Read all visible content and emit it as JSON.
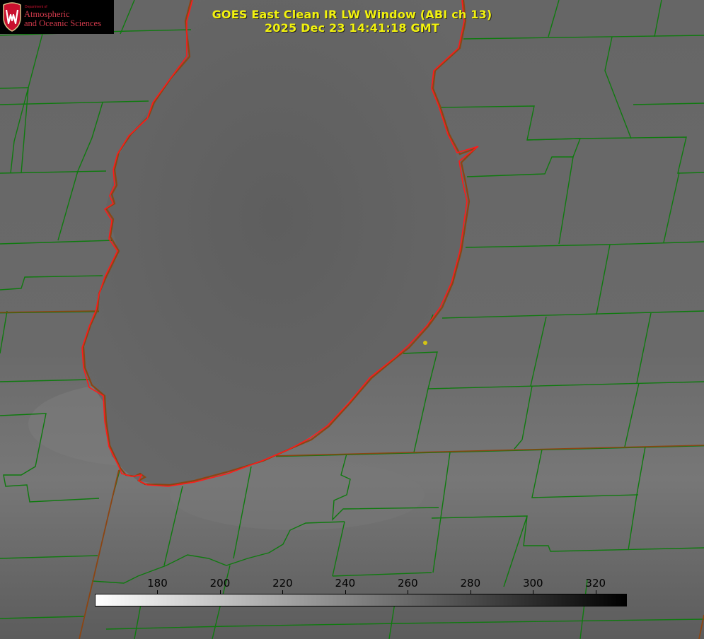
{
  "title": {
    "line1": "GOES East Clean IR LW Window (ABI ch 13)",
    "line2": "2025 Dec 23 14:41:18 GMT"
  },
  "logo": {
    "department": "Department of",
    "line1": "Atmospheric",
    "line2": "and Oceanic Sciences",
    "shield_letter": "W",
    "color": "#c8102e"
  },
  "colorbar": {
    "min": 160,
    "max": 330,
    "ticks": [
      "180",
      "200",
      "220",
      "240",
      "260",
      "280",
      "300",
      "320"
    ],
    "gradient_start": "#ffffff",
    "gradient_end": "#000000"
  },
  "colors": {
    "county_lines": "#0f7a0f",
    "state_lines": "#8b4513",
    "lake_outline": "#ff1a1a",
    "marker": "#d4c414",
    "title_text": "#f2f20e"
  }
}
